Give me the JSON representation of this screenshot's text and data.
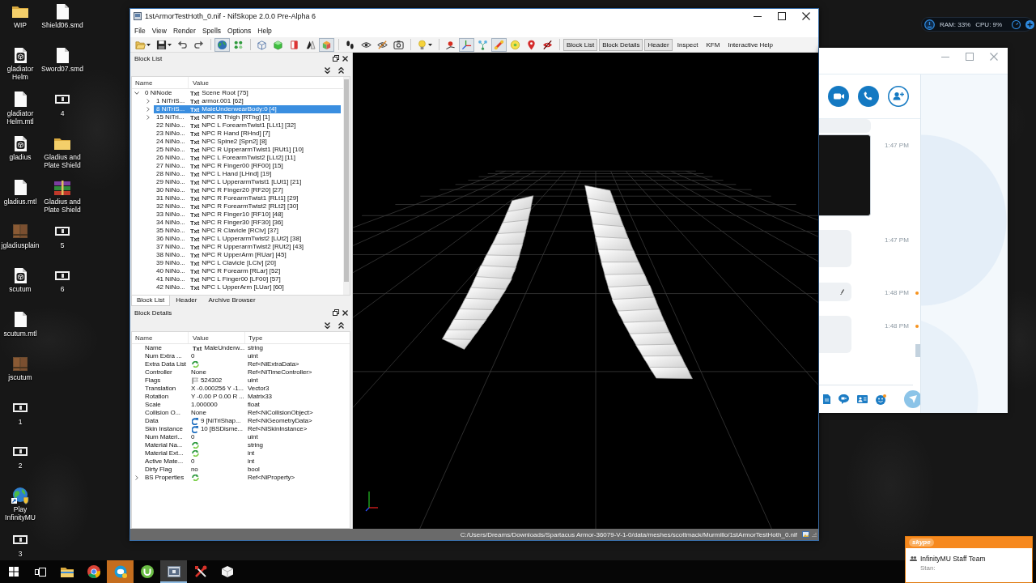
{
  "desktop_icons": [
    {
      "label": "WIP",
      "kind": "folder"
    },
    {
      "label": "gladiator Helm",
      "kind": "model"
    },
    {
      "label": "gladiator Helm.mtl",
      "kind": "file"
    },
    {
      "label": "gladius",
      "kind": "model"
    },
    {
      "label": "gladius.mtl",
      "kind": "file"
    },
    {
      "label": "jgladiusplain",
      "kind": "texture"
    },
    {
      "label": "scutum",
      "kind": "model"
    },
    {
      "label": "scutum.mtl",
      "kind": "file"
    },
    {
      "label": "jscutum",
      "kind": "texture"
    },
    {
      "label": "1",
      "kind": "thumbnail"
    },
    {
      "label": "2",
      "kind": "thumbnail"
    },
    {
      "label": "Play InfinityMU",
      "kind": "shortcut"
    },
    {
      "label": "3",
      "kind": "thumbnail"
    },
    {
      "label": "Shield06.smd",
      "kind": "file"
    },
    {
      "label": "Sword07.smd",
      "kind": "file"
    },
    {
      "label": "4",
      "kind": "thumbnail"
    },
    {
      "label": "Gladius and Plate Shield",
      "kind": "folder"
    },
    {
      "label": "Gladius and Plate Shield",
      "kind": "archive"
    },
    {
      "label": "5",
      "kind": "thumbnail"
    },
    {
      "label": "6",
      "kind": "thumbnail"
    }
  ],
  "nifskope": {
    "title": "1stArmorTestHoth_0.nif - NifSkope 2.0.0 Pre-Alpha 6",
    "menu": [
      "File",
      "View",
      "Render",
      "Spells",
      "Options",
      "Help"
    ],
    "toolbar": {
      "groups": [
        [
          {
            "pressed": false
          },
          {
            "pressed": false
          },
          {
            "pressed": false
          },
          {
            "pressed": false
          }
        ],
        [
          {
            "pressed": true
          },
          {
            "pressed": false
          }
        ],
        [
          {
            "pressed": false
          },
          {
            "pressed": false
          },
          {
            "pressed": false
          },
          {
            "pressed": false
          },
          {
            "pressed": true
          }
        ],
        [
          {
            "pressed": false
          },
          {
            "pressed": false
          },
          {
            "pressed": false
          },
          {
            "pressed": false
          }
        ],
        [
          {
            "pressed": false
          }
        ],
        [
          {
            "pressed": false
          },
          {
            "pressed": true
          },
          {
            "pressed": false
          },
          {
            "pressed": true
          },
          {
            "pressed": false
          },
          {
            "pressed": false
          },
          {
            "pressed": false
          }
        ]
      ],
      "views": [
        {
          "label": "Block List",
          "checked": true
        },
        {
          "label": "Block Details",
          "checked": true
        },
        {
          "label": "Header",
          "checked": true
        },
        {
          "label": "Inspect",
          "checked": false
        },
        {
          "label": "KFM",
          "checked": false
        },
        {
          "label": "Interactive Help",
          "checked": false
        }
      ]
    },
    "block_list": {
      "title": "Block List",
      "columns": [
        "Name",
        "Value"
      ],
      "tree": [
        {
          "name": "0 NiNode",
          "badge": "Txt",
          "value": "Scene Root [75]",
          "expanded": true,
          "selected": false,
          "children": [
            {
              "name": "1 NiTriS...",
              "badge": "Txt",
              "value": "armor.001 [62]",
              "expanded": false,
              "selected": false
            },
            {
              "name": "8 NiTriS...",
              "badge": "Txt",
              "value": "MaleUnderwearBody:0 [4]",
              "expanded": false,
              "selected": true
            },
            {
              "name": "15 NiTri...",
              "badge": "Txt",
              "value": "NPC R Thigh [RThg] [1]",
              "expanded": false,
              "selected": false
            },
            {
              "name": "22 NiNo...",
              "badge": "Txt",
              "value": "NPC L ForearmTwist1 [LLt1] [32]",
              "selected": false
            },
            {
              "name": "23 NiNo...",
              "badge": "Txt",
              "value": "NPC R Hand [RHnd] [7]",
              "selected": false
            },
            {
              "name": "24 NiNo...",
              "badge": "Txt",
              "value": "NPC Spine2 [Spn2] [8]",
              "selected": false
            },
            {
              "name": "25 NiNo...",
              "badge": "Txt",
              "value": "NPC R UpperarmTwist1 [RUt1] [10]",
              "selected": false
            },
            {
              "name": "26 NiNo...",
              "badge": "Txt",
              "value": "NPC L ForearmTwist2 [LLt2] [11]",
              "selected": false
            },
            {
              "name": "27 NiNo...",
              "badge": "Txt",
              "value": "NPC R Finger00 [RF00] [15]",
              "selected": false
            },
            {
              "name": "28 NiNo...",
              "badge": "Txt",
              "value": "NPC L Hand [LHnd] [19]",
              "selected": false
            },
            {
              "name": "29 NiNo...",
              "badge": "Txt",
              "value": "NPC L UpperarmTwist1 [LUt1] [21]",
              "selected": false
            },
            {
              "name": "30 NiNo...",
              "badge": "Txt",
              "value": "NPC R Finger20 [RF20] [27]",
              "selected": false
            },
            {
              "name": "31 NiNo...",
              "badge": "Txt",
              "value": "NPC R ForearmTwist1 [RLt1] [29]",
              "selected": false
            },
            {
              "name": "32 NiNo...",
              "badge": "Txt",
              "value": "NPC R ForearmTwist2 [RLt2] [30]",
              "selected": false
            },
            {
              "name": "33 NiNo...",
              "badge": "Txt",
              "value": "NPC R Finger10 [RF10] [48]",
              "selected": false
            },
            {
              "name": "34 NiNo...",
              "badge": "Txt",
              "value": "NPC R Finger30 [RF30] [36]",
              "selected": false
            },
            {
              "name": "35 NiNo...",
              "badge": "Txt",
              "value": "NPC R Clavicle [RClv] [37]",
              "selected": false
            },
            {
              "name": "36 NiNo...",
              "badge": "Txt",
              "value": "NPC L UpperarmTwist2 [LUt2] [38]",
              "selected": false
            },
            {
              "name": "37 NiNo...",
              "badge": "Txt",
              "value": "NPC R UpperarmTwist2 [RUt2] [43]",
              "selected": false
            },
            {
              "name": "38 NiNo...",
              "badge": "Txt",
              "value": "NPC R UpperArm [RUar] [45]",
              "selected": false
            },
            {
              "name": "39 NiNo...",
              "badge": "Txt",
              "value": "NPC L Clavicle [LClv] [20]",
              "selected": false
            },
            {
              "name": "40 NiNo...",
              "badge": "Txt",
              "value": "NPC R Forearm [RLar] [52]",
              "selected": false
            },
            {
              "name": "41 NiNo...",
              "badge": "Txt",
              "value": "NPC L Finger00 [LF00] [57]",
              "selected": false
            },
            {
              "name": "42 NiNo...",
              "badge": "Txt",
              "value": "NPC L UpperArm [LUar] [60]",
              "selected": false
            }
          ]
        }
      ]
    },
    "tabs": [
      {
        "label": "Block List",
        "selected": true
      },
      {
        "label": "Header",
        "selected": false
      },
      {
        "label": "Archive Browser",
        "selected": false
      }
    ],
    "block_details": {
      "title": "Block Details",
      "columns": [
        "Name",
        "Value",
        "Type"
      ],
      "rows": [
        {
          "name": "Name",
          "kind": "text",
          "badge": "Txt",
          "value": "MaleUnderw...",
          "type": "string"
        },
        {
          "name": "Num Extra ...",
          "kind": "plain",
          "value": "0",
          "type": "uint"
        },
        {
          "name": "Extra Data List",
          "kind": "empty-ref",
          "type": "Ref<NiExtraData>"
        },
        {
          "name": "Controller",
          "kind": "plain",
          "value": "None",
          "type": "Ref<NiTimeController>"
        },
        {
          "name": "Flags",
          "kind": "flags",
          "value": "524302",
          "type": "uint"
        },
        {
          "name": "Translation",
          "kind": "plain",
          "value": "X -0.000256 Y -1...",
          "type": "Vector3"
        },
        {
          "name": "Rotation",
          "kind": "plain",
          "value": "Y -0.00 P 0.00 R ...",
          "type": "Matrix33"
        },
        {
          "name": "Scale",
          "kind": "plain",
          "value": "1.000000",
          "type": "float"
        },
        {
          "name": "Collision O...",
          "kind": "plain",
          "value": "None",
          "type": "Ref<NiCollisionObject>"
        },
        {
          "name": "Data",
          "kind": "link",
          "value": "9 [NiTriShap...",
          "type": "Ref<NiGeometryData>"
        },
        {
          "name": "Skin Instance",
          "kind": "link",
          "value": "10 [BSDisme...",
          "type": "Ref<NiSkinInstance>"
        },
        {
          "name": "Num Materi...",
          "kind": "plain",
          "value": "0",
          "type": "uint"
        },
        {
          "name": "Material Na...",
          "kind": "empty-ref",
          "type": "string"
        },
        {
          "name": "Material Ext...",
          "kind": "empty-ref",
          "type": "int"
        },
        {
          "name": "Active Mate...",
          "kind": "plain",
          "value": "0",
          "type": "int"
        },
        {
          "name": "Dirty Flag",
          "kind": "plain",
          "value": "no",
          "type": "bool"
        },
        {
          "name": "BS Properties",
          "kind": "empty-ref",
          "type": "Ref<NiProperty>",
          "expanded": false
        }
      ]
    },
    "status_bar": {
      "path": "C:/Users/Dreams/Downloads/Spartacus Armor-36079-V-1-0/data/meshes/scottmack/Murmillo/1stArmorTestHoth_0.nif"
    }
  },
  "chat_window": {
    "messages": [
      {
        "kind": "image",
        "time": "1:47 PM",
        "edited": false,
        "pending": false
      },
      {
        "kind": "block",
        "time": "1:47 PM",
        "edited": false,
        "pending": false
      },
      {
        "kind": "line",
        "time": "1:48 PM",
        "edited": true,
        "pending": true
      },
      {
        "kind": "block",
        "time": "1:48 PM",
        "edited": false,
        "pending": true
      }
    ]
  },
  "system_monitor": {
    "ram": "RAM: 33%",
    "cpu": "CPU: 9%"
  },
  "notification": {
    "logo": "skype",
    "title": "InfinityMU Staff Team",
    "preview": "Stan:"
  },
  "taskbar": {
    "apps": [
      {
        "selected": false,
        "flashing": false
      },
      {
        "selected": false,
        "flashing": false
      },
      {
        "selected": false,
        "flashing": true
      },
      {
        "selected": false,
        "flashing": false
      },
      {
        "selected": true,
        "flashing": false
      },
      {
        "selected": false,
        "flashing": false
      },
      {
        "selected": false,
        "flashing": false
      }
    ]
  }
}
